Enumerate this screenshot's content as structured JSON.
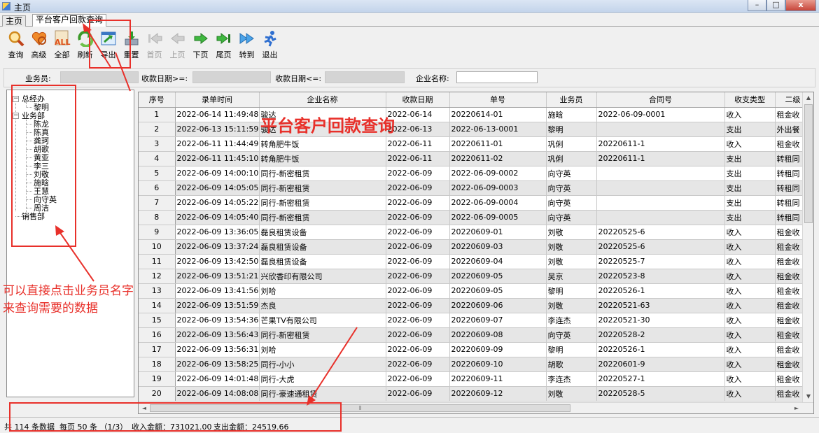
{
  "window": {
    "title": "主页",
    "controls": [
      "–",
      "□",
      "x"
    ]
  },
  "tabs": [
    {
      "label": "主页"
    },
    {
      "label": "平台客户回款查询"
    }
  ],
  "toolbar": {
    "buttons": [
      {
        "label": "查询",
        "icon": "magnifier-icon"
      },
      {
        "label": "高级",
        "icon": "heart-icon"
      },
      {
        "label": "全部",
        "icon": "all-icon"
      },
      {
        "label": "刷新",
        "icon": "refresh-icon"
      },
      {
        "label": "导出",
        "icon": "export-icon"
      },
      {
        "label": "重置",
        "icon": "reset-icon"
      },
      {
        "label": "首页",
        "icon": "first-page-icon",
        "disabled": true
      },
      {
        "label": "上页",
        "icon": "prev-page-icon",
        "disabled": true
      },
      {
        "label": "下页",
        "icon": "next-page-icon"
      },
      {
        "label": "尾页",
        "icon": "last-page-icon"
      },
      {
        "label": "转到",
        "icon": "goto-icon"
      },
      {
        "label": "退出",
        "icon": "exit-runner-icon"
      }
    ]
  },
  "filters": {
    "salesperson_label": "业务员:",
    "date_from_label": "收款日期>=:",
    "date_to_label": "收款日期<=:",
    "company_label": "企业名称:"
  },
  "tree": {
    "groups": [
      {
        "label": "总经办",
        "children": [
          "黎明"
        ]
      },
      {
        "label": "业务部",
        "children": [
          "陈龙",
          "陈真",
          "龚珂",
          "胡歌",
          "黄亚",
          "李三",
          "刘敬",
          "施晗",
          "王慧",
          "向守英",
          "周洁"
        ]
      },
      {
        "label": "销售部",
        "children": []
      }
    ]
  },
  "grid": {
    "columns": [
      "序号",
      "录单时间",
      "企业名称",
      "收款日期",
      "单号",
      "业务员",
      "合同号",
      "收支类型",
      "二级"
    ],
    "rows": [
      [
        "1",
        "2022-06-14 11:49:48",
        "骏达",
        "2022-06-14",
        "20220614-01",
        "施晗",
        "2022-06-09-0001",
        "收入",
        "租金收"
      ],
      [
        "2",
        "2022-06-13 15:11:59",
        "骏达",
        "2022-06-13",
        "2022-06-13-0001",
        "黎明",
        "",
        "支出",
        "外出餐"
      ],
      [
        "3",
        "2022-06-11 11:44:49",
        "转角肥牛饭",
        "2022-06-11",
        "20220611-01",
        "巩俐",
        "20220611-1",
        "收入",
        "租金收"
      ],
      [
        "4",
        "2022-06-11 11:45:10",
        "转角肥牛饭",
        "2022-06-11",
        "20220611-02",
        "巩俐",
        "20220611-1",
        "支出",
        "转租同"
      ],
      [
        "5",
        "2022-06-09 14:00:10",
        "同行-新密租赁",
        "2022-06-09",
        "2022-06-09-0002",
        "向守英",
        "",
        "支出",
        "转租同"
      ],
      [
        "6",
        "2022-06-09 14:05:05",
        "同行-新密租赁",
        "2022-06-09",
        "2022-06-09-0003",
        "向守英",
        "",
        "支出",
        "转租同"
      ],
      [
        "7",
        "2022-06-09 14:05:22",
        "同行-新密租赁",
        "2022-06-09",
        "2022-06-09-0004",
        "向守英",
        "",
        "支出",
        "转租同"
      ],
      [
        "8",
        "2022-06-09 14:05:40",
        "同行-新密租赁",
        "2022-06-09",
        "2022-06-09-0005",
        "向守英",
        "",
        "支出",
        "转租同"
      ],
      [
        "9",
        "2022-06-09 13:36:05",
        "磊良租赁设备",
        "2022-06-09",
        "20220609-01",
        "刘敬",
        "20220525-6",
        "收入",
        "租金收"
      ],
      [
        "10",
        "2022-06-09 13:37:24",
        "磊良租赁设备",
        "2022-06-09",
        "20220609-03",
        "刘敬",
        "20220525-6",
        "收入",
        "租金收"
      ],
      [
        "11",
        "2022-06-09 13:42:50",
        "磊良租赁设备",
        "2022-06-09",
        "20220609-04",
        "刘敬",
        "20220525-7",
        "收入",
        "租金收"
      ],
      [
        "12",
        "2022-06-09 13:51:21",
        "兴欣香印有限公司",
        "2022-06-09",
        "20220609-05",
        "吴京",
        "20220523-8",
        "收入",
        "租金收"
      ],
      [
        "13",
        "2022-06-09 13:41:56",
        "刘哈",
        "2022-06-09",
        "20220609-05",
        "黎明",
        "20220526-1",
        "收入",
        "租金收"
      ],
      [
        "14",
        "2022-06-09 13:51:59",
        "杰良",
        "2022-06-09",
        "20220609-06",
        "刘敬",
        "20220521-63",
        "收入",
        "租金收"
      ],
      [
        "15",
        "2022-06-09 13:54:36",
        "芒果TV有限公司",
        "2022-06-09",
        "20220609-07",
        "李连杰",
        "20220521-30",
        "收入",
        "租金收"
      ],
      [
        "16",
        "2022-06-09 13:56:43",
        "同行-新密租赁",
        "2022-06-09",
        "20220609-08",
        "向守英",
        "20220528-2",
        "收入",
        "租金收"
      ],
      [
        "17",
        "2022-06-09 13:56:31",
        "刘哈",
        "2022-06-09",
        "20220609-09",
        "黎明",
        "20220526-1",
        "收入",
        "租金收"
      ],
      [
        "18",
        "2022-06-09 13:58:25",
        "同行-小小",
        "2022-06-09",
        "20220609-10",
        "胡歌",
        "20220601-9",
        "收入",
        "租金收"
      ],
      [
        "19",
        "2022-06-09 14:01:48",
        "同行-大虎",
        "2022-06-09",
        "20220609-11",
        "李连杰",
        "20220527-1",
        "收入",
        "租金收"
      ],
      [
        "20",
        "2022-06-09 14:08:08",
        "同行-豪速通租赁",
        "2022-06-09",
        "20220609-12",
        "刘敬",
        "20220528-5",
        "收入",
        "租金收"
      ]
    ]
  },
  "statusbar": {
    "total": "共 114 条数据",
    "per_page": "每页 50 条 （1/3）",
    "income": "收入金额：731021.00",
    "expense": "支出金额：24519.66"
  },
  "annotations": {
    "grid_caption": "平台客户回款查询",
    "tree_hint_line1": "可以直接点击业务员名字",
    "tree_hint_line2": "来查询需要的数据"
  },
  "colors": {
    "annotation_red": "#e8302a",
    "alt_row": "#e6e6e6",
    "header_bg": "#f0f0f0"
  }
}
